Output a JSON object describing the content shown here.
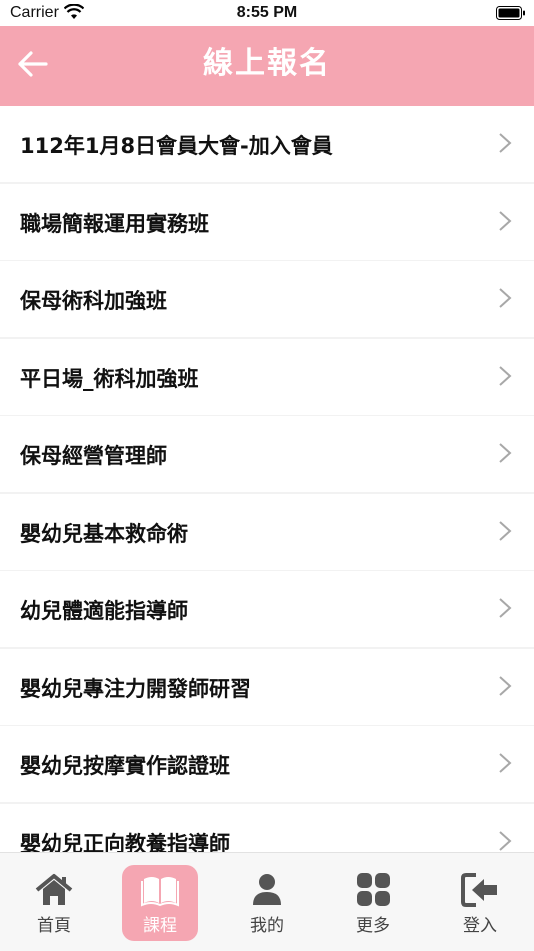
{
  "status": {
    "carrier": "Carrier",
    "time": "8:55 PM"
  },
  "header": {
    "title": "線上報名"
  },
  "items": [
    {
      "label": "112年1月8日會員大會-加入會員"
    },
    {
      "label": "職場簡報運用實務班"
    },
    {
      "label": "保母術科加強班"
    },
    {
      "label": "平日場_術科加強班"
    },
    {
      "label": "保母經營管理師"
    },
    {
      "label": "嬰幼兒基本救命術"
    },
    {
      "label": "幼兒體適能指導師"
    },
    {
      "label": "嬰幼兒專注力開發師研習"
    },
    {
      "label": "嬰幼兒按摩實作認證班"
    },
    {
      "label": "嬰幼兒正向教養指導師"
    }
  ],
  "tabs": [
    {
      "label": "首頁",
      "icon": "home-icon",
      "active": false
    },
    {
      "label": "課程",
      "icon": "book-icon",
      "active": true
    },
    {
      "label": "我的",
      "icon": "person-icon",
      "active": false
    },
    {
      "label": "更多",
      "icon": "grid-icon",
      "active": false
    },
    {
      "label": "登入",
      "icon": "login-icon",
      "active": false
    }
  ],
  "colors": {
    "accent": "#f5a6b2",
    "icon_gray": "#555555",
    "background": "#f2f2f2"
  }
}
